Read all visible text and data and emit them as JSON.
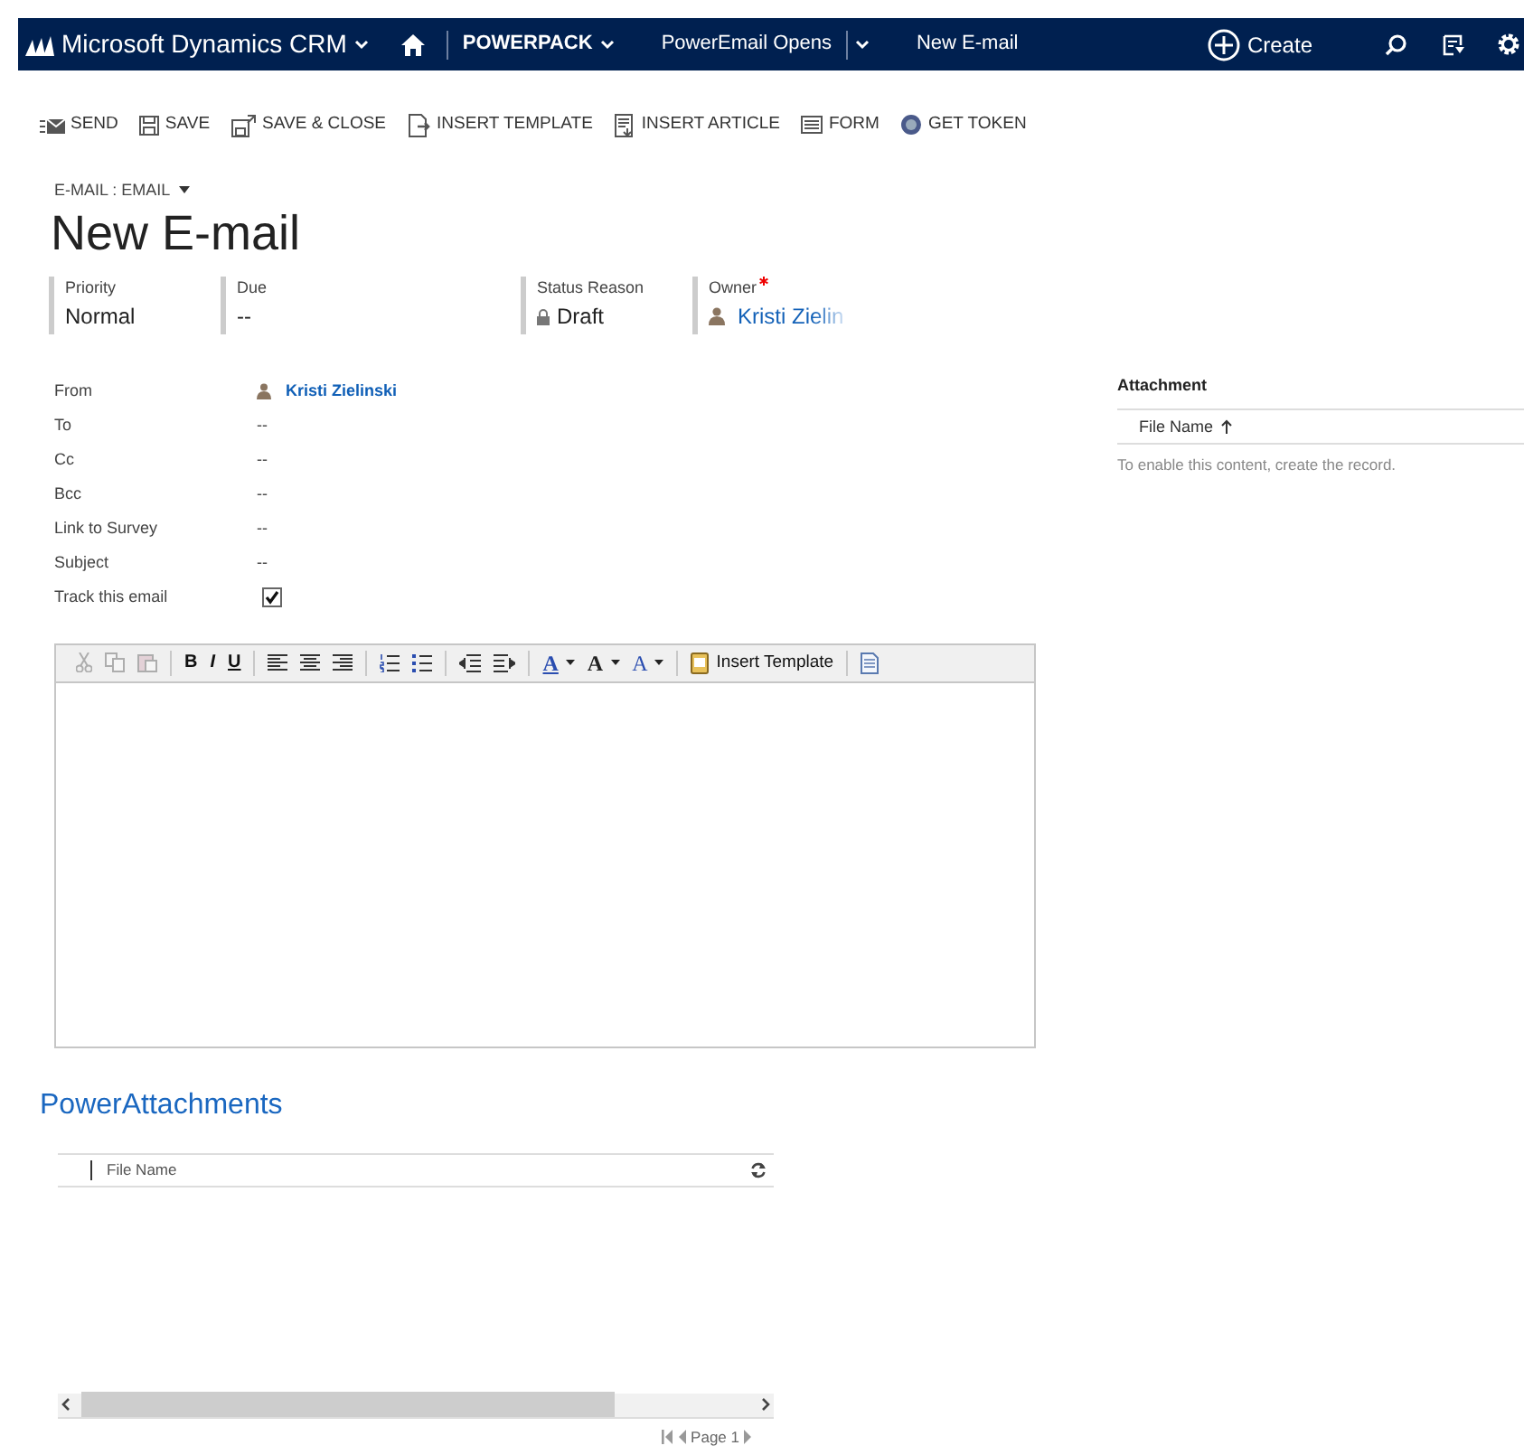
{
  "navbar": {
    "app_title": "Microsoft Dynamics CRM",
    "items": [
      {
        "label": "POWERPACK",
        "kind": "menu"
      },
      {
        "label": "PowerEmail Opens",
        "kind": "split"
      },
      {
        "label": "New E-mail",
        "kind": "plain"
      }
    ],
    "create_label": "Create"
  },
  "command_bar": [
    {
      "label": "SEND"
    },
    {
      "label": "SAVE"
    },
    {
      "label": "SAVE & CLOSE"
    },
    {
      "label": "INSERT TEMPLATE"
    },
    {
      "label": "INSERT ARTICLE"
    },
    {
      "label": "FORM"
    },
    {
      "label": "GET TOKEN"
    }
  ],
  "breadcrumb": "E-MAIL : EMAIL",
  "title": "New E-mail",
  "header_fields": [
    {
      "label": "Priority",
      "value": "Normal",
      "kind": "text",
      "required": false
    },
    {
      "label": "Due",
      "value": "--",
      "kind": "text",
      "required": false
    },
    {
      "label": "Status Reason",
      "value": "Draft",
      "kind": "locked",
      "required": false
    },
    {
      "label": "Owner",
      "value": "Kristi Zielin",
      "kind": "lookup",
      "required": true
    }
  ],
  "form_fields": [
    {
      "label": "From",
      "value": "Kristi Zielinski",
      "kind": "lookup"
    },
    {
      "label": "To",
      "value": "--",
      "kind": "text"
    },
    {
      "label": "Cc",
      "value": "--",
      "kind": "text"
    },
    {
      "label": "Bcc",
      "value": "--",
      "kind": "text"
    },
    {
      "label": "Link to Survey",
      "value": "--",
      "kind": "text"
    },
    {
      "label": "Subject",
      "value": "--",
      "kind": "text"
    },
    {
      "label": "Track this email",
      "kind": "checkbox",
      "checked": true
    }
  ],
  "editor_toolbar": [
    [
      {
        "kind": "icon",
        "disabled": true
      },
      {
        "kind": "icon",
        "disabled": true
      },
      {
        "kind": "icon",
        "disabled": true
      }
    ],
    [
      {
        "kind": "letter",
        "text": "B",
        "disabled": false
      },
      {
        "kind": "letter",
        "text": "I",
        "disabled": false
      },
      {
        "kind": "letter",
        "text": "U",
        "disabled": false
      }
    ],
    [
      {
        "kind": "icon",
        "disabled": false
      },
      {
        "kind": "icon",
        "disabled": false
      },
      {
        "kind": "icon",
        "disabled": false
      }
    ],
    [
      {
        "kind": "icon",
        "disabled": false
      },
      {
        "kind": "icon",
        "disabled": false
      }
    ],
    [
      {
        "kind": "icon",
        "disabled": false
      },
      {
        "kind": "icon",
        "disabled": false
      }
    ],
    [
      {
        "kind": "dropdown",
        "text": "A",
        "disabled": false
      },
      {
        "kind": "dropdown",
        "text": "A",
        "disabled": false
      },
      {
        "kind": "dropdown",
        "text": "A",
        "disabled": false
      }
    ],
    [
      {
        "kind": "button",
        "text": "Insert Template",
        "disabled": false
      }
    ],
    [
      {
        "kind": "icon",
        "disabled": false
      }
    ]
  ],
  "attachment": {
    "title": "Attachment",
    "column": "File Name",
    "message": "To enable this content, create the record."
  },
  "power_attachments": {
    "title": "PowerAttachments",
    "column": "File Name",
    "pager": "Page 1"
  }
}
